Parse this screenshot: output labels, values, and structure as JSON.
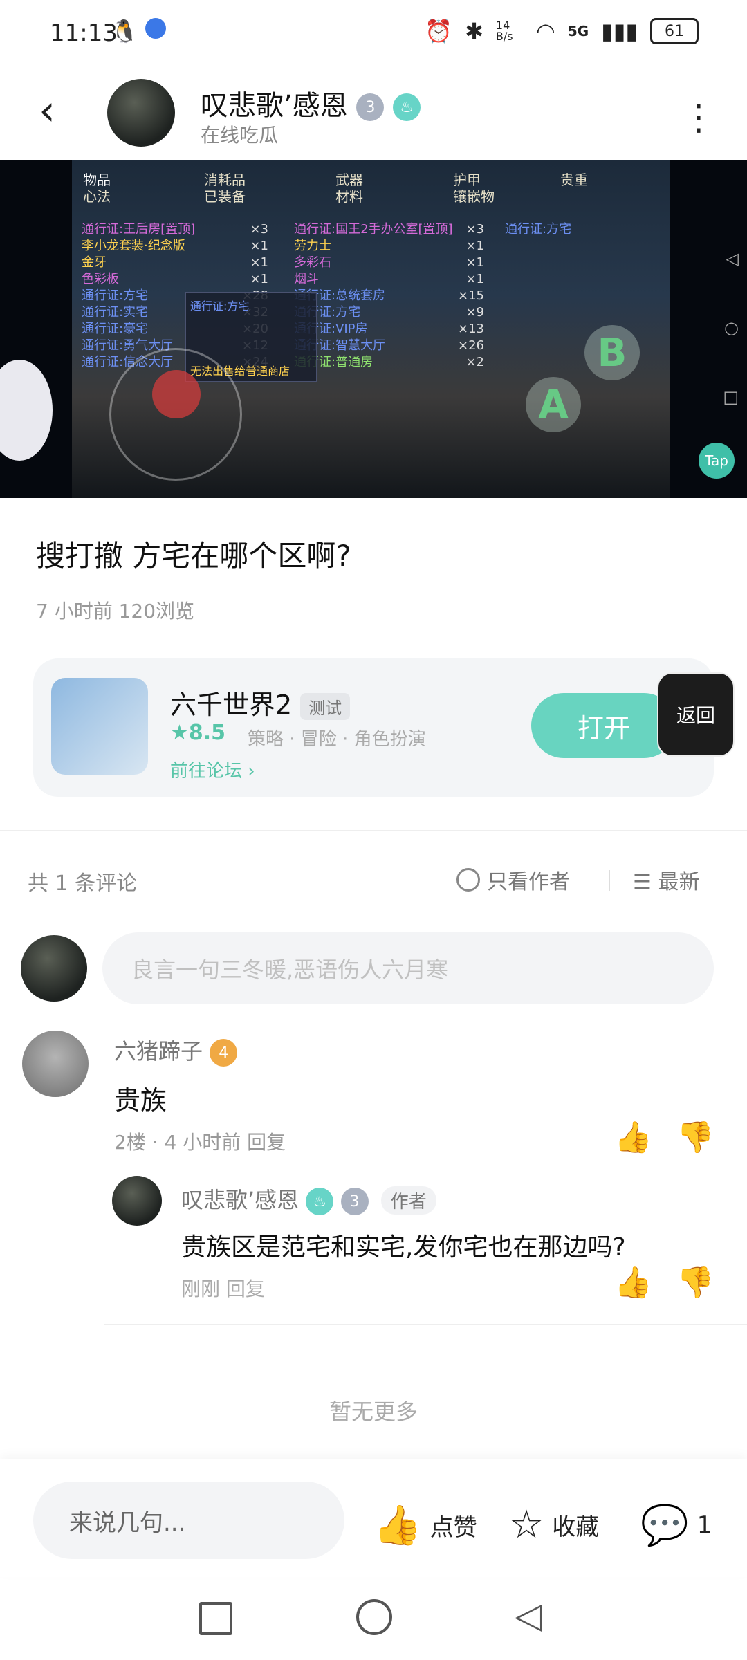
{
  "status_bar": {
    "time": "11:13",
    "net_speed": "14 B/s",
    "network": "5G",
    "battery": "61"
  },
  "header": {
    "name": "叹悲歌’感恩",
    "subtitle": "在线吃瓜",
    "badge_level": "3"
  },
  "game_screen": {
    "tabs": [
      "物品",
      "消耗品",
      "武器",
      "护甲",
      "贵重",
      "心法",
      "已装备",
      "材料",
      "镶嵌物"
    ],
    "col1": [
      {
        "t": "通行证:王后房[置顶]",
        "n": "×3",
        "c": "gm"
      },
      {
        "t": "李小龙套装·纪念版",
        "n": "×1",
        "c": "gy"
      },
      {
        "t": "金牙",
        "n": "×1",
        "c": "gy"
      },
      {
        "t": "色彩板",
        "n": "×1",
        "c": "gm"
      },
      {
        "t": "通行证:方宅",
        "n": "×28",
        "c": "gb"
      },
      {
        "t": "通行证:实宅",
        "n": "×32",
        "c": "gb"
      },
      {
        "t": "通行证:豪宅",
        "n": "×20",
        "c": "gb"
      },
      {
        "t": "通行证:勇气大厅",
        "n": "×12",
        "c": "gb"
      },
      {
        "t": "通行证:信念大厅",
        "n": "×24",
        "c": "gb"
      }
    ],
    "col2": [
      {
        "t": "通行证:国王2手办公室[置顶]",
        "n": "×3",
        "c": "gm"
      },
      {
        "t": "劳力士",
        "n": "×1",
        "c": "gy"
      },
      {
        "t": "多彩石",
        "n": "×1",
        "c": "gm"
      },
      {
        "t": "烟斗",
        "n": "×1",
        "c": "gm"
      },
      {
        "t": "通行证:总统套房",
        "n": "×15",
        "c": "gb"
      },
      {
        "t": "通行证:方宅",
        "n": "×9",
        "c": "gb"
      },
      {
        "t": "通行证:VIP房",
        "n": "×13",
        "c": "gb"
      },
      {
        "t": "通行证:智慧大厅",
        "n": "×26",
        "c": "gb"
      },
      {
        "t": "通行证:普通房",
        "n": "×2",
        "c": "gg"
      }
    ],
    "col3": [
      {
        "t": "通行证:方宅",
        "c": "gb"
      }
    ],
    "tooltip_title": "通行证:方宅",
    "tooltip_footer": "无法出售给普通商店",
    "btn_a": "A",
    "btn_b": "B",
    "tap_logo": "Tap"
  },
  "post": {
    "title": "搜打撤 方宅在哪个区啊?",
    "meta": "7 小时前  120浏览"
  },
  "game_card": {
    "title": "六千世界2",
    "tag": "测试",
    "rating": "★8.5",
    "genre": "策略 · 冒险 · 角色扮演",
    "link": "前往论坛 ›",
    "open_button": "打开"
  },
  "float_back": "返回",
  "comments_bar": {
    "count": "共 1 条评论",
    "author_only": "只看作者",
    "sort": "最新"
  },
  "comment_input_placeholder": "良言一句三冬暖,恶语伤人六月寒",
  "comment": {
    "name": "六猪蹄子",
    "badge_level": "4",
    "text": "贵族",
    "meta": "2楼 · 4 小时前  回复",
    "reply": {
      "name": "叹悲歌’感恩",
      "author_tag": "作者",
      "badge_level": "3",
      "text": "贵族区是范宅和实宅,发你宅也在那边吗?",
      "meta": "刚刚  回复"
    }
  },
  "no_more": "暂无更多",
  "bottom_bar": {
    "input": "来说几句...",
    "like": "点赞",
    "favorite": "收藏",
    "comment_count": "1"
  }
}
